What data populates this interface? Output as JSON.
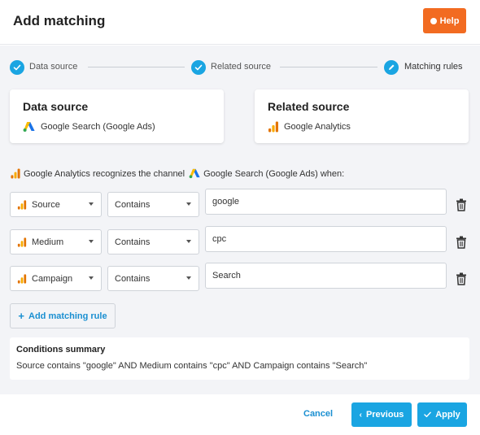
{
  "header": {
    "title": "Add matching",
    "help_label": "Help",
    "help_color": "#f26b21"
  },
  "steps": [
    {
      "label": "Data source",
      "done": true
    },
    {
      "label": "Related source",
      "done": true
    },
    {
      "label": "Matching rules",
      "current": true
    }
  ],
  "cards": {
    "data_source": {
      "title": "Data source",
      "source": "Google Search (Google Ads)",
      "icon": "google-ads-icon"
    },
    "related_source": {
      "title": "Related source",
      "source": "Google Analytics",
      "icon": "google-analytics-icon"
    }
  },
  "recognize": {
    "part1": "Google Analytics recognizes the channel",
    "part2": "Google Search (Google Ads) when:"
  },
  "rules": [
    {
      "field": "Source",
      "operator": "Contains",
      "value": "google"
    },
    {
      "field": "Medium",
      "operator": "Contains",
      "value": "cpc"
    },
    {
      "field": "Campaign",
      "operator": "Contains",
      "value": "Search"
    }
  ],
  "add_rule_label": "Add matching rule",
  "summary": {
    "title": "Conditions summary",
    "text": "Source contains \"google\" AND Medium contains \"cpc\" AND Campaign contains \"Search\""
  },
  "footer": {
    "cancel": "Cancel",
    "previous": "Previous",
    "apply": "Apply"
  },
  "colors": {
    "accent": "#1aa5e2",
    "link": "#1a8fd1",
    "help": "#f26b21",
    "background": "#f3f4f7"
  }
}
